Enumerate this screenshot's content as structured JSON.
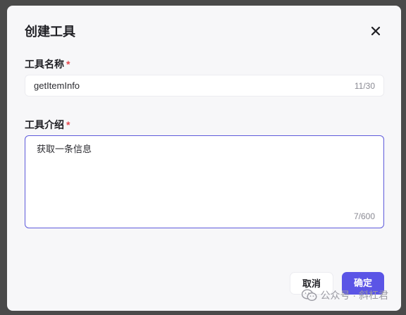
{
  "dialog": {
    "title": "创建工具",
    "close_icon": "close-icon"
  },
  "fields": {
    "name": {
      "label": "工具名称",
      "required_mark": "*",
      "value": "getItemInfo",
      "counter": "11/30"
    },
    "description": {
      "label": "工具介绍",
      "required_mark": "*",
      "value": "获取一条信息",
      "counter": "7/600"
    }
  },
  "actions": {
    "cancel_label": "取消",
    "confirm_label": "确定"
  },
  "watermark": {
    "icon": "wechat-icon",
    "text": "公众号 · 斜杠君"
  },
  "colors": {
    "accent": "#5b55e6",
    "required": "#e5484d",
    "focus_border": "#5e5adb"
  }
}
